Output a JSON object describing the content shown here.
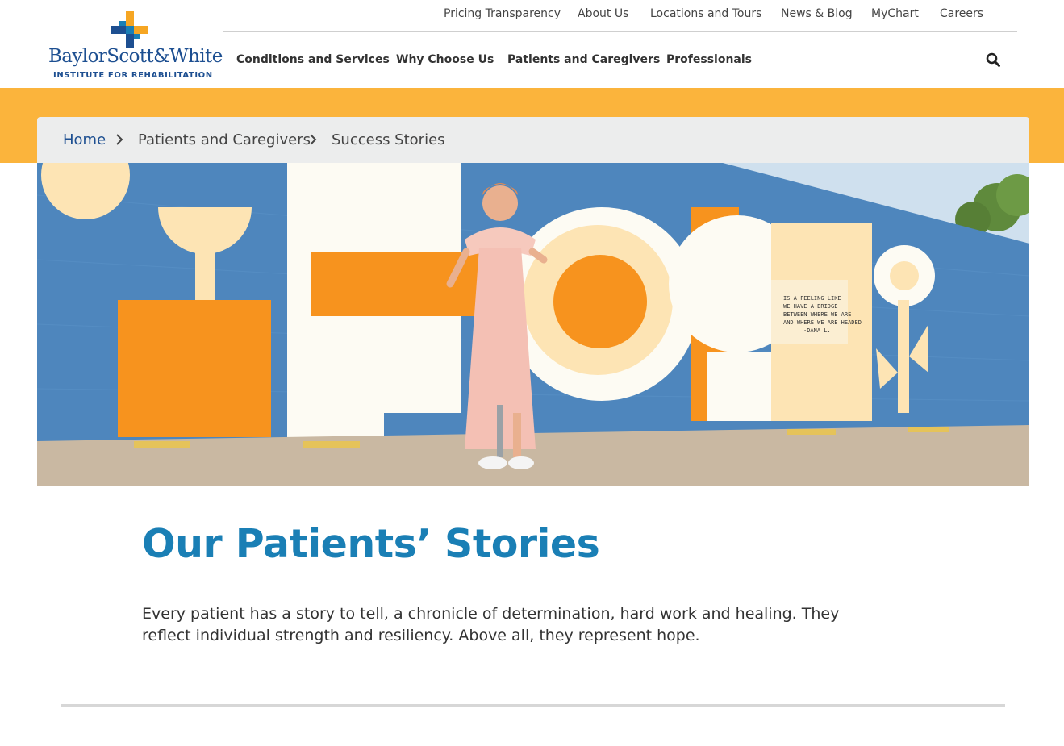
{
  "logo": {
    "wordmark": "BaylorScott&White",
    "subtitle": "INSTITUTE FOR REHABILITATION"
  },
  "utility_nav": [
    {
      "label": "Pricing Transparency"
    },
    {
      "label": "About Us"
    },
    {
      "label": "Locations and Tours"
    },
    {
      "label": "News & Blog"
    },
    {
      "label": "MyChart"
    },
    {
      "label": "Careers"
    }
  ],
  "main_nav": [
    {
      "label": "Conditions and Services"
    },
    {
      "label": "Why Choose Us"
    },
    {
      "label": "Patients and Caregivers"
    },
    {
      "label": "Professionals"
    }
  ],
  "search": {
    "icon": "search-icon"
  },
  "breadcrumb": [
    {
      "label": "Home"
    },
    {
      "label": "Patients and Caregivers"
    },
    {
      "label": "Success Stories"
    }
  ],
  "hero": {
    "mural_quote": [
      "IS A FEELING LIKE",
      "WE HAVE A BRIDGE",
      "BETWEEN WHERE WE ARE",
      "AND WHERE WE ARE HEADED",
      "-DANA L."
    ]
  },
  "content": {
    "title": "Our Patients’ Stories",
    "intro": "Every patient has a story to tell, a chronicle of determination, hard work and healing. They reflect individual strength and resiliency. Above all, they represent hope."
  },
  "colors": {
    "brand_blue": "#1d4f91",
    "title_blue": "#1a7fb5",
    "accent_orange": "#fbb43c",
    "breadcrumb_bg": "#eceded"
  }
}
